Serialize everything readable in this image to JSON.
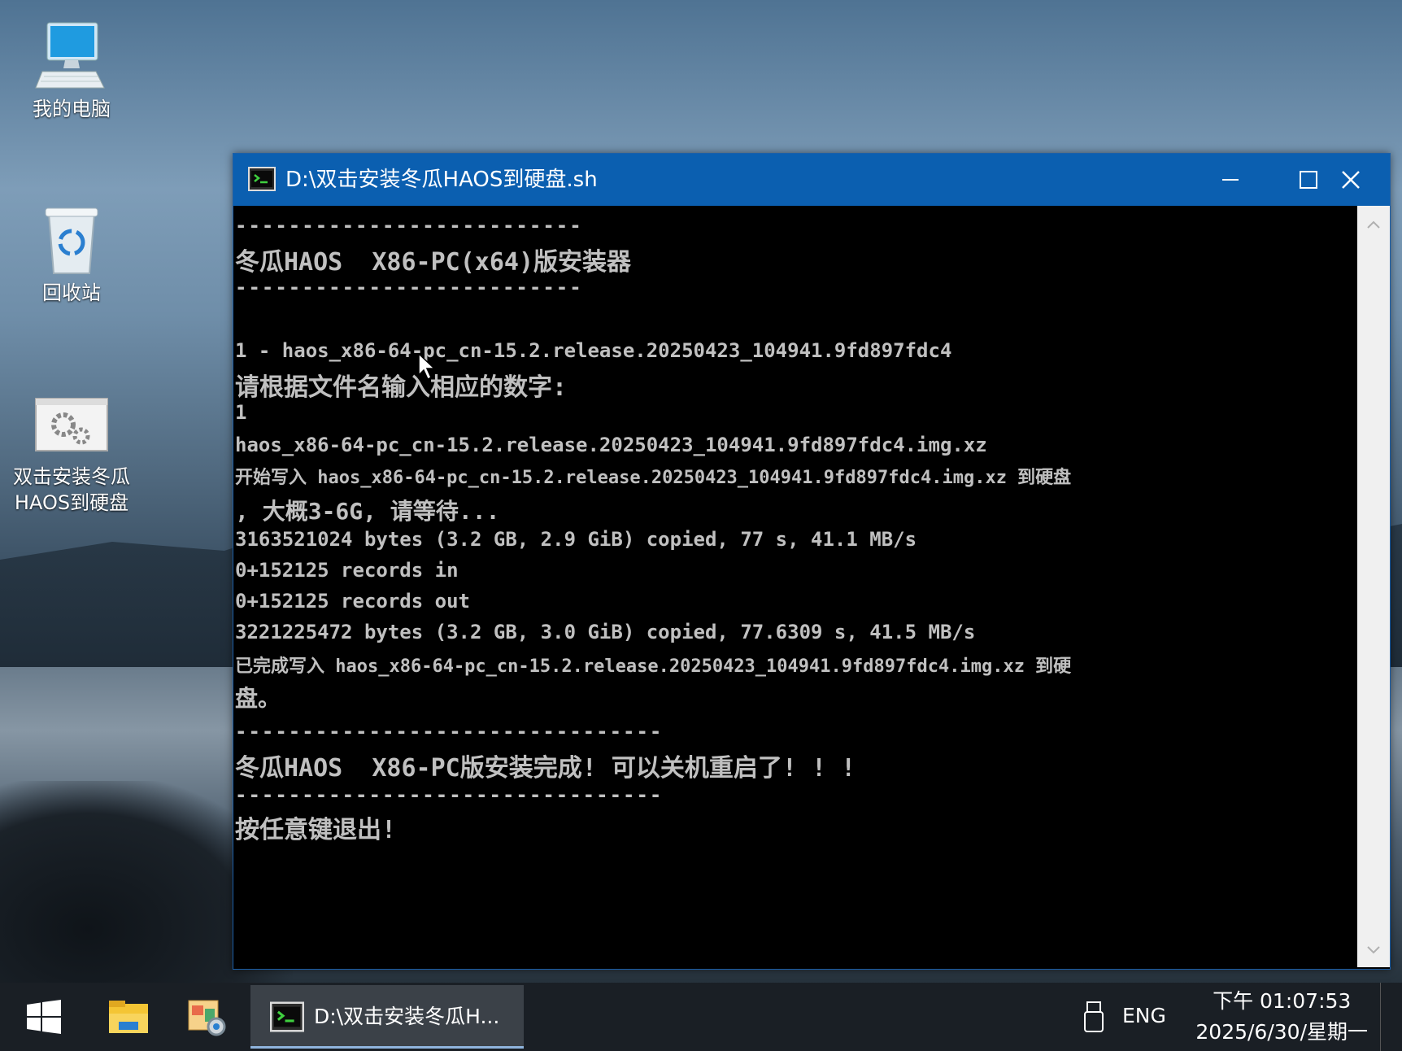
{
  "desktop": {
    "icons": [
      {
        "label": "我的电脑",
        "icon": "computer-icon"
      },
      {
        "label": "回收站",
        "icon": "recycle-bin-icon"
      },
      {
        "label_line1": "双击安装冬瓜",
        "label_line2": "HAOS到硬盘",
        "icon": "script-file-icon"
      }
    ]
  },
  "window": {
    "title": "D:\\双击安装冬瓜HAOS到硬盘.sh",
    "lines": [
      "--------------------------",
      "冬瓜HAOS  X86-PC(x64)版安装器",
      "--------------------------",
      "1 - haos_x86-64-pc_cn-15.2.release.20250423_104941.9fd897fdc4",
      "请根据文件名输入相应的数字:",
      "1",
      "haos_x86-64-pc_cn-15.2.release.20250423_104941.9fd897fdc4.img.xz",
      "开始写入 haos_x86-64-pc_cn-15.2.release.20250423_104941.9fd897fdc4.img.xz 到硬盘",
      ", 大概3-6G, 请等待...",
      "3163521024 bytes (3.2 GB, 2.9 GiB) copied, 77 s, 41.1 MB/s",
      "0+152125 records in",
      "0+152125 records out",
      "3221225472 bytes (3.2 GB, 3.0 GiB) copied, 77.6309 s, 41.5 MB/s",
      "已完成写入 haos_x86-64-pc_cn-15.2.release.20250423_104941.9fd897fdc4.img.xz 到硬",
      "盘。",
      "--------------------------------",
      "冬瓜HAOS  X86-PC版安装完成! 可以关机重启了! ! !",
      "--------------------------------",
      "按任意键退出!"
    ]
  },
  "taskbar": {
    "task_label": "D:\\双击安装冬瓜H...",
    "language": "ENG",
    "time": "下午 01:07:53",
    "date": "2025/6/30/星期一"
  },
  "colors": {
    "titlebar": "#0b5fb0",
    "console_bg": "#000000",
    "console_text": "#c0c0c0",
    "taskbar": "#1a1f25"
  }
}
